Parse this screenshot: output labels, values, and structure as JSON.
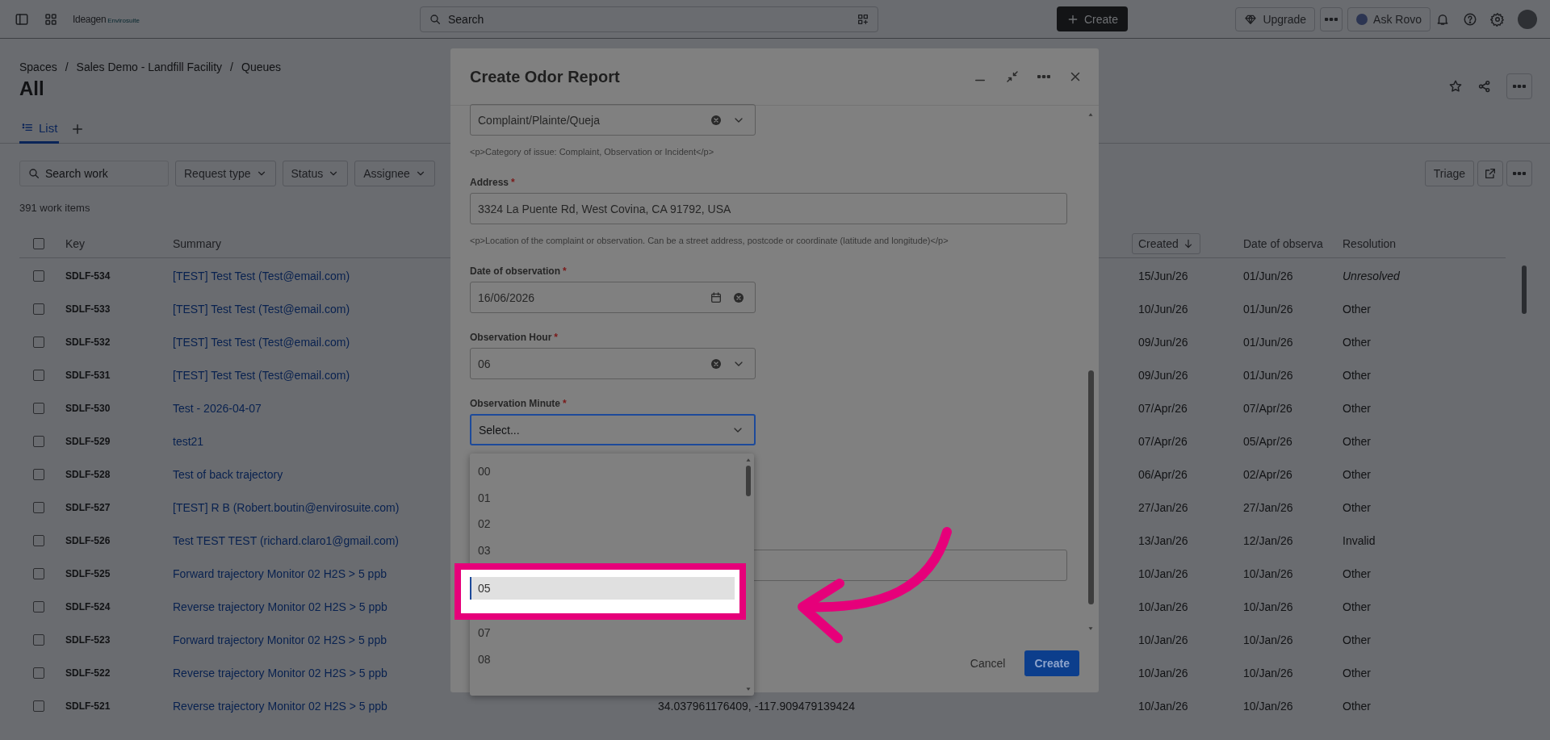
{
  "topbar": {
    "logo": "Ideagen",
    "logo_sub": "Envirosuite",
    "search": {
      "placeholder": "Search"
    },
    "create": "Create",
    "upgrade": "Upgrade",
    "ask": "Ask Rovo"
  },
  "page": {
    "breadcrumbs": [
      {
        "text": "Spaces",
        "separator": "/"
      },
      {
        "text": "Sales Demo - Landfill Facility",
        "separator": "/"
      },
      {
        "text": "Queues"
      }
    ],
    "title": "All",
    "tabs": [
      {
        "label": "List",
        "selected": true
      }
    ],
    "search": {
      "placeholder": "Search work"
    },
    "filters": [
      "Request type",
      "Status",
      "Assignee"
    ],
    "count": "391 work items",
    "triage": "Triage"
  },
  "table": {
    "header_checked": false,
    "columns": [
      {
        "label": "Key",
        "sorted": false
      },
      {
        "label": "Summary",
        "sorted": false
      },
      {
        "label": "Created",
        "sorted": true
      },
      {
        "label": "Date of observa",
        "sorted": false
      },
      {
        "label": "Resolution",
        "sorted": false
      }
    ],
    "rows": [
      {
        "checked": false,
        "key": "SDLF-534",
        "summary": "[TEST] Test Test (Test@email.com)",
        "created": "15/Jun/26",
        "observed": "01/Jun/26",
        "resolution": "Unresolved",
        "resolved": false
      },
      {
        "checked": false,
        "key": "SDLF-533",
        "summary": "[TEST] Test Test (Test@email.com)",
        "created": "10/Jun/26",
        "observed": "01/Jun/26",
        "resolution": "Other",
        "resolved": true
      },
      {
        "checked": false,
        "key": "SDLF-532",
        "summary": "[TEST] Test Test (Test@email.com)",
        "created": "09/Jun/26",
        "observed": "01/Jun/26",
        "resolution": "Other",
        "resolved": true
      },
      {
        "checked": false,
        "key": "SDLF-531",
        "summary": "[TEST] Test Test (Test@email.com)",
        "created": "09/Jun/26",
        "observed": "01/Jun/26",
        "resolution": "Other",
        "resolved": true
      },
      {
        "checked": false,
        "key": "SDLF-530",
        "summary": "Test - 2026-04-07",
        "created": "07/Apr/26",
        "observed": "07/Apr/26",
        "resolution": "Other",
        "resolved": true
      },
      {
        "checked": false,
        "key": "SDLF-529",
        "summary": "test21",
        "created": "07/Apr/26",
        "observed": "05/Apr/26",
        "resolution": "Other",
        "resolved": true
      },
      {
        "checked": false,
        "key": "SDLF-528",
        "summary": "Test of back trajectory",
        "created": "06/Apr/26",
        "observed": "02/Apr/26",
        "resolution": "Other",
        "resolved": true
      },
      {
        "checked": false,
        "key": "SDLF-527",
        "summary": "[TEST] R B (Robert.boutin@envirosuite.com)",
        "created": "27/Jan/26",
        "observed": "27/Jan/26",
        "resolution": "Other",
        "resolved": true
      },
      {
        "checked": false,
        "key": "SDLF-526",
        "summary": "Test TEST TEST (richard.claro1@gmail.com)",
        "created": "13/Jan/26",
        "observed": "12/Jan/26",
        "resolution": "Invalid",
        "resolved": true
      },
      {
        "checked": false,
        "key": "SDLF-525",
        "summary": "Forward trajectory Monitor 02 H2S > 5 ppb",
        "created": "10/Jan/26",
        "observed": "10/Jan/26",
        "resolution": "Other",
        "resolved": true
      },
      {
        "checked": false,
        "key": "SDLF-524",
        "summary": "Reverse trajectory Monitor 02 H2S > 5 ppb",
        "created": "10/Jan/26",
        "observed": "10/Jan/26",
        "resolution": "Other",
        "resolved": true
      },
      {
        "checked": false,
        "key": "SDLF-523",
        "summary": "Forward trajectory Monitor 02 H2S > 5 ppb",
        "created": "10/Jan/26",
        "observed": "10/Jan/26",
        "resolution": "Other",
        "resolved": true
      },
      {
        "checked": false,
        "key": "SDLF-522",
        "summary": "Reverse trajectory Monitor 02 H2S > 5 ppb",
        "created": "10/Jan/26",
        "observed": "10/Jan/26",
        "resolution": "Other",
        "resolved": true
      },
      {
        "checked": false,
        "key": "SDLF-521",
        "summary": "Reverse trajectory Monitor 02 H2S > 5 ppb",
        "column_4": "34.037961176409, -117.909479139424",
        "created": "10/Jan/26",
        "observed": "10/Jan/26",
        "resolution": "Other",
        "resolved": true
      }
    ]
  },
  "modal": {
    "title": "Create Odor Report",
    "fields": [
      {
        "kind": "select",
        "value": "Complaint/Plainte/Queja",
        "help": "<p>Category of issue: Complaint, Observation or Incident</p>"
      },
      {
        "kind": "text",
        "label": "Address",
        "required_mark": "*",
        "value": "3324 La Puente Rd, West Covina, CA 91792, USA",
        "help": "<p>Location of the complaint or observation. Can be a street address, postcode or coordinate (latitude and longitude)</p>"
      },
      {
        "kind": "date",
        "label": "Date of observation",
        "required_mark": "*",
        "value": "16/06/2026"
      },
      {
        "kind": "select",
        "label": "Observation Hour",
        "required_mark": "*",
        "value": "06"
      },
      {
        "kind": "select",
        "label": "Observation Minute",
        "required_mark": "*",
        "placeholder": "Select...",
        "focused": true
      }
    ],
    "options": [
      {
        "label": "00",
        "focused": false
      },
      {
        "label": "01",
        "focused": false
      },
      {
        "label": "02",
        "focused": false
      },
      {
        "label": "03",
        "focused": false
      },
      {
        "label": "05",
        "focused": true
      },
      {
        "label": "07",
        "focused": false
      },
      {
        "label": "08",
        "focused": false
      }
    ],
    "cancel": "Cancel",
    "submit": "Create"
  }
}
